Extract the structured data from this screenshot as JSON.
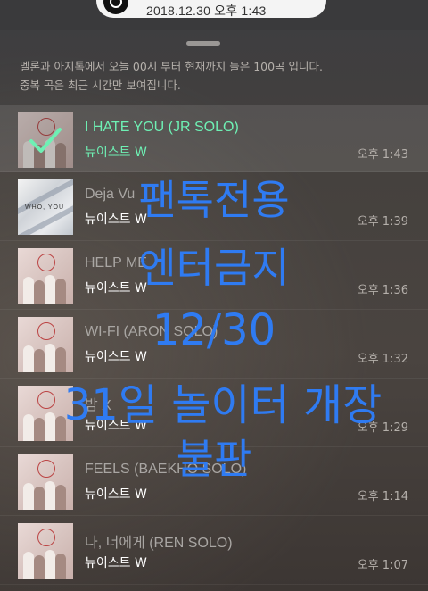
{
  "status": {
    "datetime": "2018.12.30 오후 1:43"
  },
  "notice": {
    "line1": "멜론과 아지톡에서 오늘 00시 부터 현재까지 들은 100곡 입니다.",
    "line2": "중복 곡은 최근 시간만 보여집니다."
  },
  "songs": [
    {
      "title": "I HATE YOU (JR SOLO)",
      "artist": "뉴이스트 W",
      "time": "오후 1:43"
    },
    {
      "title": "Deja Vu",
      "artist": "뉴이스트 W",
      "time": "오후 1:39"
    },
    {
      "title": "HELP ME",
      "artist": "뉴이스트 W",
      "time": "오후 1:36"
    },
    {
      "title": "WI-FI (ARON SOLO)",
      "artist": "뉴이스트 W",
      "time": "오후 1:32"
    },
    {
      "title": "밤 X",
      "artist": "뉴이스트 W",
      "time": "오후 1:29"
    },
    {
      "title": "FEELS (BAEKHO SOLO)",
      "artist": "뉴이스트 W",
      "time": "오후 1:14"
    },
    {
      "title": "나, 너에게 (REN SOLO)",
      "artist": "뉴이스트 W",
      "time": "오후 1:07"
    }
  ],
  "album_alt_tag": "WHO, YOU",
  "overlay": {
    "line1": "팬톡전용",
    "line2": "엔터금지",
    "line3": "12/30",
    "line4": "31일 놀이터 개장",
    "line5": "불판"
  },
  "colors": {
    "accent": "#6ef0b4",
    "overlay_text": "#2f7bf2"
  }
}
